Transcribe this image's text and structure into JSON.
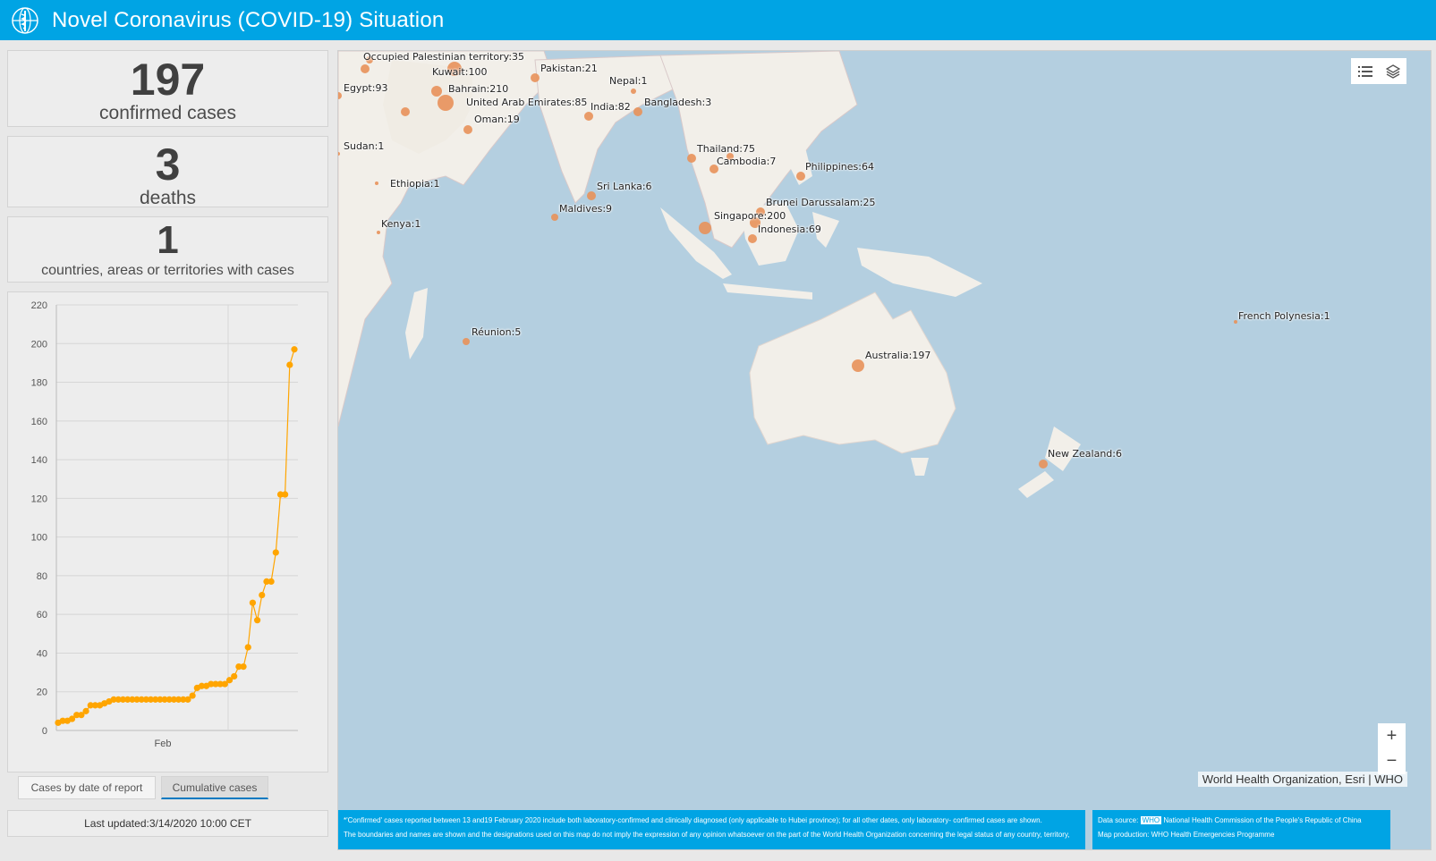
{
  "header": {
    "title": "Novel Coronavirus (COVID-19) Situation",
    "logo_icon": "who-emblem-icon"
  },
  "stats": [
    {
      "value": "197",
      "label": "confirmed cases"
    },
    {
      "value": "3",
      "label": "deaths"
    },
    {
      "value": "1",
      "label": "countries, areas or territories with cases"
    }
  ],
  "tabs": [
    {
      "label": "Cases by date of report",
      "active": false
    },
    {
      "label": "Cumulative cases",
      "active": true
    }
  ],
  "last_updated": "Last updated:3/14/2020 10:00 CET",
  "chart_data": {
    "type": "line",
    "xlabel": "",
    "ylabel": "",
    "x_tick_labels": [
      "Feb"
    ],
    "y_ticks": [
      0,
      20,
      40,
      60,
      80,
      100,
      120,
      140,
      160,
      180,
      200,
      220
    ],
    "ylim": [
      0,
      220
    ],
    "grid": true,
    "color": "#ffa500",
    "series": [
      {
        "values": [
          4,
          5,
          5,
          6,
          8,
          8,
          10,
          13,
          13,
          13,
          14,
          15,
          16,
          16,
          16,
          16,
          16,
          16,
          16,
          16,
          16,
          16,
          16,
          16,
          16,
          16,
          16,
          16,
          16,
          18,
          22,
          23,
          23,
          24,
          24,
          24,
          24,
          26,
          28,
          33,
          33,
          43,
          66,
          57,
          70,
          77,
          77,
          92,
          122,
          122,
          189,
          197
        ]
      }
    ]
  },
  "map": {
    "labels": [
      "Occupied Palestinian territory:35",
      "Kuwait:100",
      "Pakistan:21",
      "Nepal:1",
      "Egypt:93",
      "Bahrain:210",
      "United Arab Emirates:85",
      "India:82",
      "Bangladesh:3",
      "Oman:19",
      "Sudan:1",
      "Thailand:75",
      "Cambodia:7",
      "Philippines:64",
      "Ethiopia:1",
      "Sri Lanka:6",
      "Brunei Darussalam:25",
      "Maldives:9",
      "Singapore:200",
      "Kenya:1",
      "Indonesia:69",
      "Réunion:5",
      "French Polynesia:1",
      "Australia:197",
      "New Zealand:6"
    ],
    "attribution": "World Health Organization, Esri | WHO",
    "zoom_in": "+",
    "zoom_out": "−",
    "point_color": "#e8915a",
    "water_color": "#b4cfe0",
    "land_color": "#f2efe9"
  },
  "footer": {
    "left_line1": "*'Confirmed' cases reported between 13 and19 February 2020 include both laboratory-confirmed and clinically diagnosed (only  applicable to Hubei province); for all other dates, only laboratory-  confirmed cases are shown.",
    "left_line2": "The boundaries and names are shown and the designations used on this map do not imply the expression of any opinion whatsoever on the part of the World Health Organization concerning the legal status of any country, territory,",
    "right_prefix": "Data source:",
    "right_highlight": "WHO",
    "right_source": "National Health Commission of the People's Republic of China",
    "right_line2": "Map production: WHO Health Emergencies Programme"
  }
}
